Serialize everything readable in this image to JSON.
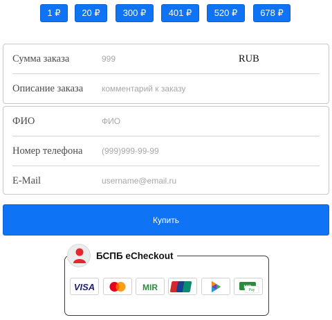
{
  "amount_buttons": [
    {
      "label": "1 ₽"
    },
    {
      "label": "20 ₽"
    },
    {
      "label": "300 ₽"
    },
    {
      "label": "401 ₽"
    },
    {
      "label": "520 ₽"
    },
    {
      "label": "678 ₽"
    }
  ],
  "order": {
    "amount_label": "Сумма заказа",
    "amount_placeholder": "999",
    "currency": "RUB",
    "description_label": "Описание заказа",
    "description_placeholder": "комментарий к заказу"
  },
  "customer": {
    "name_label": "ФИО",
    "name_placeholder": "ФИО",
    "phone_label": "Номер телефона",
    "phone_placeholder": "(999)999-99-99",
    "email_label": "E-Mail",
    "email_placeholder": "username@email.ru"
  },
  "buy_button_label": "Купить",
  "checkout": {
    "title": "БСПБ eCheckout",
    "payment_methods": [
      "visa-icon",
      "mastercard-icon",
      "mir-icon",
      "unionpay-icon",
      "sbp-icon",
      "mir-pay-icon"
    ],
    "colors": {
      "accent": "#0f73f5",
      "logo_red": "#e3262f"
    }
  }
}
